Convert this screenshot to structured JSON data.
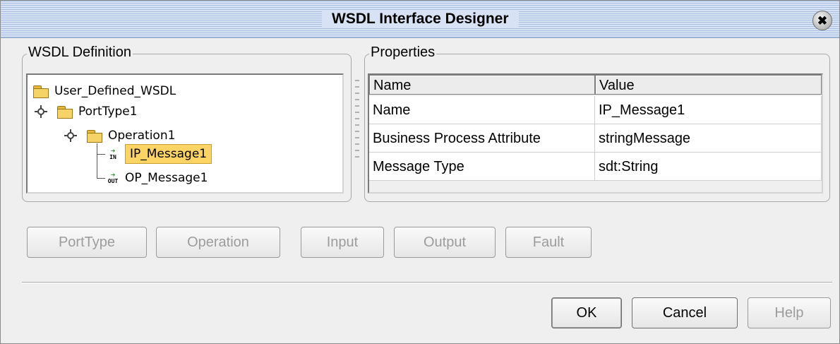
{
  "window": {
    "title": "WSDL Interface Designer",
    "close_glyph": "✖"
  },
  "wsdl_definition": {
    "label": "WSDL Definition",
    "tree": {
      "root": "User_Defined_WSDL",
      "port_type": "PortType1",
      "operation": "Operation1",
      "input_message": "IP_Message1",
      "output_message": "OP_Message1",
      "input_icon_text": "IN",
      "output_icon_text": "OUT"
    }
  },
  "properties": {
    "label": "Properties",
    "columns": [
      "Name",
      "Value"
    ],
    "rows": [
      {
        "name": "Name",
        "value": "IP_Message1"
      },
      {
        "name": "Business Process Attribute",
        "value": "stringMessage"
      },
      {
        "name": "Message Type",
        "value": "sdt:String"
      }
    ]
  },
  "actions": {
    "porttype": "PortType",
    "operation": "Operation",
    "input": "Input",
    "output": "Output",
    "fault": "Fault"
  },
  "footer": {
    "ok": "OK",
    "cancel": "Cancel",
    "help": "Help"
  },
  "colors": {
    "titlebar": "#d7e3f4",
    "selection": "#fcd466",
    "folder": "#f6d366"
  },
  "icons": {
    "close": "close-icon",
    "folder": "folder-icon",
    "input": "input-message-icon",
    "output": "output-message-icon"
  }
}
